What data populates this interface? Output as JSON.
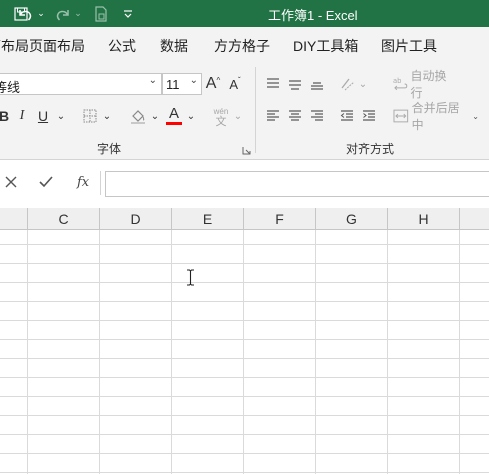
{
  "app": {
    "title": "工作簿1  -  Excel",
    "accent_color": "#217346",
    "quick_access": [
      {
        "name": "undo-icon"
      },
      {
        "name": "redo-icon"
      },
      {
        "name": "save-as-icon"
      },
      {
        "name": "customize-qat-icon"
      }
    ]
  },
  "menu": {
    "tabs": [
      "面布局",
      "页面布局",
      "公式",
      "数据",
      "方方格子",
      "DIY工具箱",
      "图片工具"
    ]
  },
  "ribbon": {
    "font_name": "等线",
    "font_size": "11",
    "increase_font_icon": "A",
    "decrease_font_icon": "A",
    "bold": "B",
    "italic": "I",
    "underline": "U",
    "font_color_letter": "A",
    "font_color": "#ff0000",
    "phonetic_top": "wén",
    "phonetic_bottom": "文",
    "font_group_label": "字体",
    "wrap_text_label": "自动换行",
    "merge_center_label": "合并后居中",
    "alignment_group_label": "对齐方式"
  },
  "formula_bar": {
    "fx_label": "fx",
    "value": ""
  },
  "sheet": {
    "columns": [
      "",
      "C",
      "D",
      "E",
      "F",
      "G",
      "H"
    ]
  }
}
